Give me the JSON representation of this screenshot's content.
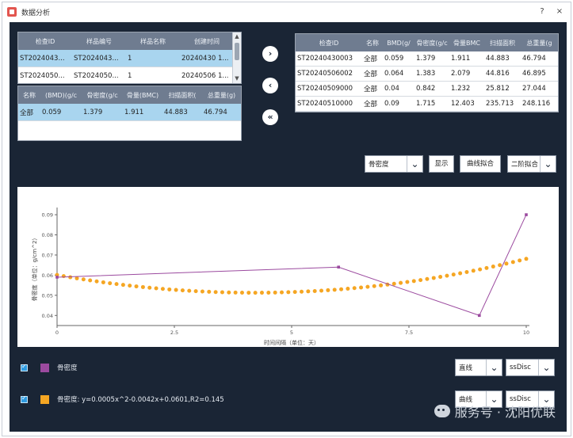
{
  "window": {
    "title": "数据分析",
    "help_glyph": "?",
    "close_glyph": "×"
  },
  "left_table": {
    "headers": [
      "检查ID",
      "样品编号",
      "样品名称",
      "创建时间"
    ],
    "rows": [
      [
        "ST2024043...",
        "ST2024043...",
        "1",
        "20240430 1..."
      ],
      [
        "ST2024050...",
        "ST2024050...",
        "1",
        "20240506 1..."
      ]
    ],
    "scroll_up": "▲",
    "scroll_down": "▼"
  },
  "detail_table": {
    "headers": [
      "名称",
      "(BMD)(g/c",
      "骨密度(g/c",
      "骨量(BMC)",
      "扫描面积(",
      "总重量(g)"
    ],
    "rows": [
      [
        "全部",
        "0.059",
        "1.379",
        "1.911",
        "44.883",
        "46.794"
      ]
    ]
  },
  "transfer_buttons": {
    "move_right": "›",
    "move_left": "‹",
    "move_all_left": "«"
  },
  "right_table": {
    "headers": [
      "检查ID",
      "名称",
      "BMD(g/",
      "骨密度(g/c",
      "骨量BMC",
      "扫描面积",
      "总重量(g"
    ],
    "rows": [
      [
        "ST20240430003",
        "全部",
        "0.059",
        "1.379",
        "1.911",
        "44.883",
        "46.794"
      ],
      [
        "ST20240506002",
        "全部",
        "0.064",
        "1.383",
        "2.079",
        "44.816",
        "46.895"
      ],
      [
        "ST20240509000",
        "全部",
        "0.04",
        "0.842",
        "1.232",
        "25.812",
        "27.044"
      ],
      [
        "ST20240510000",
        "全部",
        "0.09",
        "1.715",
        "12.403",
        "235.713",
        "248.116"
      ]
    ]
  },
  "toolbar": {
    "metric_select": "骨密度",
    "show_button": "显示",
    "fit_button": "曲线拟合",
    "fit_order_select": "二阶拟合",
    "dropdown_glyph": "⌄"
  },
  "chart_data": {
    "type": "line",
    "xlabel": "时间间隔（单位：天）",
    "ylabel": "骨密度（单位：g/cm^2）",
    "xlim": [
      0,
      10
    ],
    "ylim": [
      0.035,
      0.092
    ],
    "xticks": [
      0,
      2.5,
      5,
      7.5,
      10
    ],
    "xtick_labels": [
      "0",
      "2.5",
      "5",
      "7.5",
      "10"
    ],
    "yticks": [
      0.04,
      0.05,
      0.06,
      0.07,
      0.08,
      0.09
    ],
    "ytick_labels": [
      "0.04",
      "0.05",
      "0.06",
      "0.07",
      "0.08",
      "0.09"
    ],
    "series": [
      {
        "name": "骨密度",
        "color": "#9b4a9f",
        "style": "line-markers",
        "x": [
          0,
          6,
          9,
          10
        ],
        "y": [
          0.059,
          0.064,
          0.04,
          0.09
        ]
      },
      {
        "name": "骨密度: y=0.0005x^2-0.0042x+0.0601,R2=0.145",
        "color": "#f5a623",
        "style": "dots",
        "fit": {
          "a": 0.0005,
          "b": -0.0042,
          "c": 0.0601
        },
        "x_start": 0,
        "x_end": 10,
        "points": 72
      }
    ]
  },
  "legend": {
    "items": [
      {
        "label": "骨密度",
        "color": "#9b4a9f",
        "line_select": "直线",
        "marker_select": "ssDisc"
      },
      {
        "label": "骨密度: y=0.0005x^2-0.0042x+0.0601,R2=0.145",
        "color": "#f5a623",
        "line_select": "曲线",
        "marker_select": "ssDisc"
      }
    ]
  },
  "watermark": {
    "text": "服务号 · 沈阳优联"
  }
}
